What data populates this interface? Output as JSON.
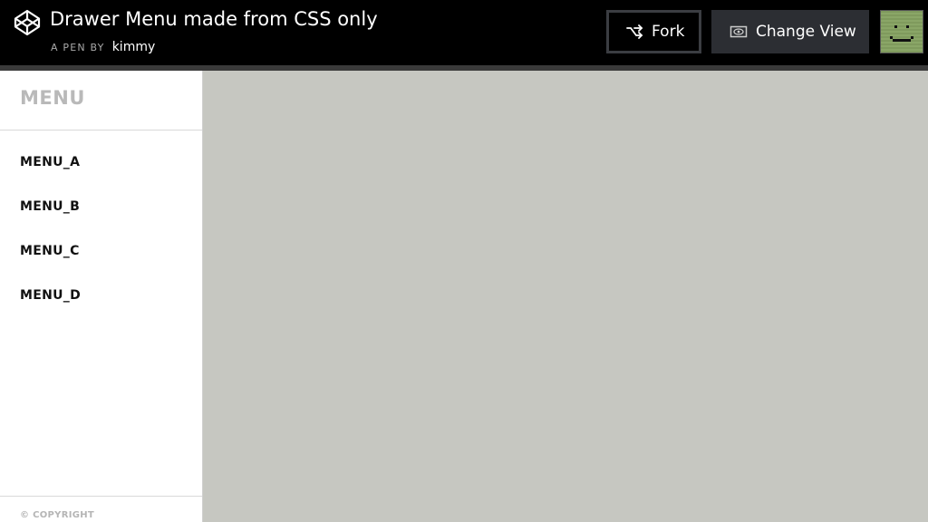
{
  "header": {
    "title": "Drawer Menu made from CSS only",
    "byline_prefix": "A PEN BY",
    "author": "kimmy",
    "logo_icon": "codepen-logo-icon",
    "fork_label": "Fork",
    "fork_icon": "fork-icon",
    "change_view_label": "Change View",
    "change_view_icon": "eye-icon"
  },
  "sidebar": {
    "heading": "MENU",
    "items": [
      {
        "label": "MENU_A"
      },
      {
        "label": "MENU_B"
      },
      {
        "label": "MENU_C"
      },
      {
        "label": "MENU_D"
      }
    ],
    "copyright": "© COPYRIGHT"
  },
  "colors": {
    "topbar": "#000000",
    "content_background": "#c6c7c1",
    "sidebar_background": "#ffffff"
  }
}
